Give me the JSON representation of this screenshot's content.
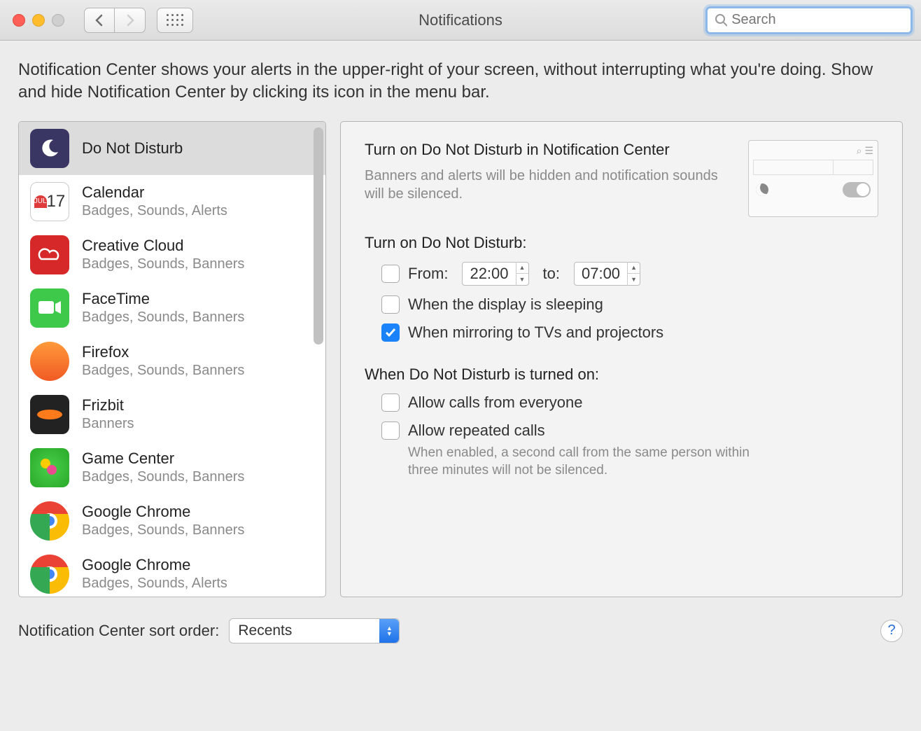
{
  "window": {
    "title": "Notifications"
  },
  "search": {
    "placeholder": "Search"
  },
  "description": "Notification Center shows your alerts in the upper-right of your screen, without interrupting what you're doing. Show and hide Notification Center by clicking its icon in the menu bar.",
  "apps": [
    {
      "name": "Do Not Disturb",
      "sub": "",
      "icon": "dnd",
      "selected": true
    },
    {
      "name": "Calendar",
      "sub": "Badges, Sounds, Alerts",
      "icon": "cal"
    },
    {
      "name": "Creative Cloud",
      "sub": "Badges, Sounds, Banners",
      "icon": "cc"
    },
    {
      "name": "FaceTime",
      "sub": "Badges, Sounds, Banners",
      "icon": "ft"
    },
    {
      "name": "Firefox",
      "sub": "Badges, Sounds, Banners",
      "icon": "ff"
    },
    {
      "name": "Frizbit",
      "sub": "Banners",
      "icon": "fz"
    },
    {
      "name": "Game Center",
      "sub": "Badges, Sounds, Banners",
      "icon": "gc"
    },
    {
      "name": "Google Chrome",
      "sub": "Badges, Sounds, Banners",
      "icon": "chrome"
    },
    {
      "name": "Google Chrome",
      "sub": "Badges, Sounds, Alerts",
      "icon": "chrome"
    }
  ],
  "detail": {
    "heading": "Turn on Do Not Disturb in Notification Center",
    "heading_sub": "Banners and alerts will be hidden and notification sounds will be silenced.",
    "schedule_title": "Turn on Do Not Disturb:",
    "from_label": "From:",
    "from_time": "22:00",
    "to_label": "to:",
    "to_time": "07:00",
    "schedule_checked": false,
    "display_sleep_label": "When the display is sleeping",
    "display_sleep_checked": false,
    "mirroring_label": "When mirroring to TVs and projectors",
    "mirroring_checked": true,
    "on_title": "When Do Not Disturb is turned on:",
    "allow_everyone_label": "Allow calls from everyone",
    "allow_everyone_checked": false,
    "allow_repeated_label": "Allow repeated calls",
    "allow_repeated_checked": false,
    "repeated_hint": "When enabled, a second call from the same person within three minutes will not be silenced."
  },
  "footer": {
    "sort_label": "Notification Center sort order:",
    "sort_value": "Recents",
    "help": "?"
  },
  "calendar_icon": {
    "month": "JUL",
    "day": "17"
  }
}
